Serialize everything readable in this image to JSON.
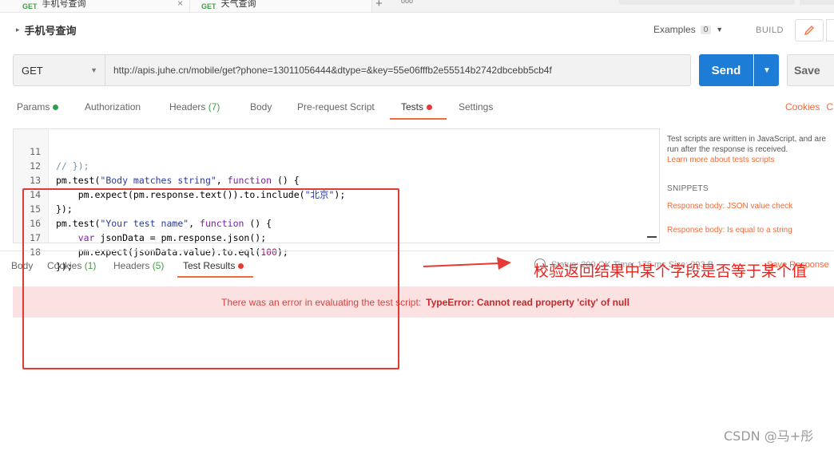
{
  "tabs": [
    {
      "method": "GET",
      "title": "手机号查询"
    },
    {
      "method": "GET",
      "title": "天气查询"
    }
  ],
  "tabs_add": "+",
  "tabs_more": "ooo",
  "request": {
    "name": "手机号查询",
    "examples_label": "Examples",
    "examples_count": "0",
    "build_label": "BUILD",
    "method": "GET",
    "url": "http://apis.juhe.cn/mobile/get?phone=13011056444&dtype=&key=55e06fffb2e55514b2742dbcebb5cb4f",
    "send_label": "Send",
    "save_label": "Save"
  },
  "request_tabs": [
    {
      "label": "Params",
      "dot": "#2e9e4f"
    },
    {
      "label": "Authorization"
    },
    {
      "label": "Headers",
      "sub": "(7)"
    },
    {
      "label": "Body"
    },
    {
      "label": "Pre-request Script"
    },
    {
      "label": "Tests",
      "dot": "#e53935",
      "active": true
    },
    {
      "label": "Settings"
    }
  ],
  "cookies_label": "Cookies",
  "cookies_trunc": "C",
  "editor": {
    "lines": [
      {
        "n": "11"
      },
      {
        "n": "12"
      },
      {
        "n": "13"
      },
      {
        "n": "14"
      },
      {
        "n": "15"
      },
      {
        "n": "16"
      },
      {
        "n": "17"
      },
      {
        "n": "18"
      }
    ]
  },
  "help": {
    "text": "Test scripts are written in JavaScript, and are run after the response is received.",
    "link": "Learn more about tests scripts",
    "snippets_heading": "SNIPPETS",
    "snippets": [
      "Response body: JSON value check",
      "Response body: Is equal to a string"
    ]
  },
  "response_tabs": [
    {
      "label": "Body"
    },
    {
      "label": "Cookies",
      "sub": "(1)"
    },
    {
      "label": "Headers",
      "sub": "(5)"
    },
    {
      "label": "Test Results",
      "dot": "#e53935",
      "active": true
    }
  ],
  "response_meta": "Status: 200 OK   Time: 175 ms   Size: 293 B",
  "save_response_label": "Save Response",
  "error": {
    "prefix": "There was an error in evaluating the test script:",
    "message": "TypeError: Cannot read property 'city' of null"
  },
  "annotation": {
    "text": "校验返回结果中某个字段是否等于某个值",
    "color": "#e8231e"
  },
  "watermark": "CSDN @马+彤",
  "colors": {
    "accent": "#f26b3a",
    "send": "#1c7cd6",
    "error_bg": "#fbe1e1"
  }
}
